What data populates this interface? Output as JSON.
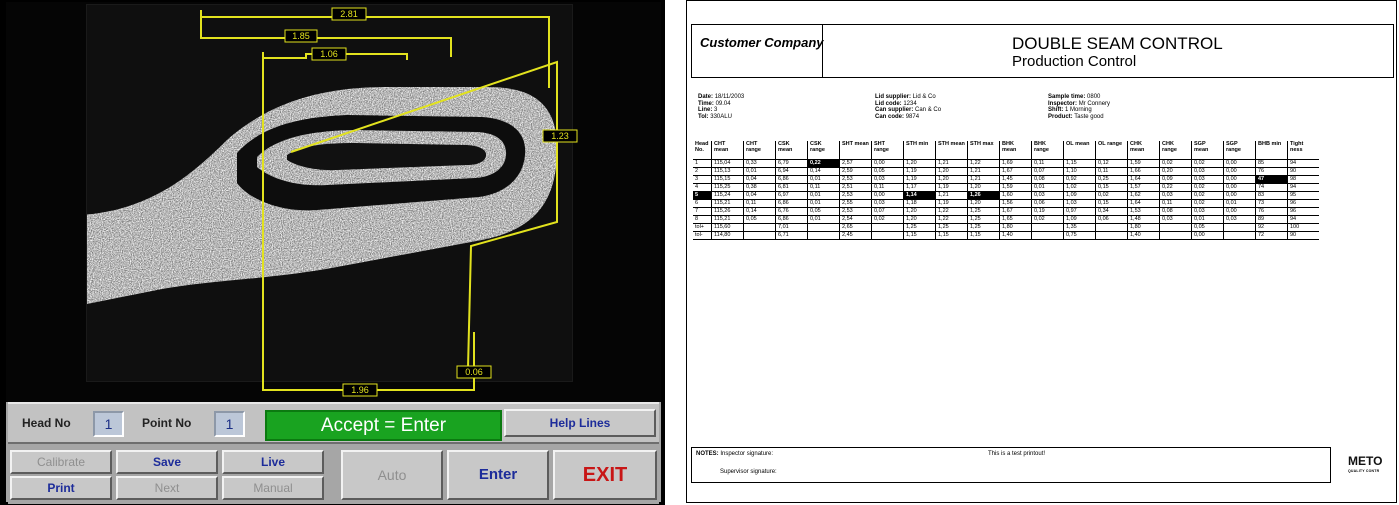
{
  "station": {
    "dimensions": [
      "2.81",
      "1.85",
      "1.06",
      "1.23",
      "0.06",
      "1.96"
    ],
    "info_bar": {
      "head_label": "Head No",
      "head_value": "1",
      "point_label": "Point No",
      "point_value": "1",
      "accept_text": "Accept = Enter",
      "help_lines_label": "Help Lines"
    },
    "buttons": {
      "calibrate": "Calibrate",
      "save": "Save",
      "live": "Live",
      "print": "Print",
      "next": "Next",
      "manual": "Manual",
      "auto": "Auto",
      "enter": "Enter",
      "exit": "EXIT"
    },
    "colors": {
      "accept_green": "#19a320",
      "button_blue": "#1d2c9a",
      "exit_red": "#c81616",
      "dimension_yellow": "#e2e21e"
    }
  },
  "report": {
    "company": "Customer Company",
    "title": "DOUBLE SEAM CONTROL",
    "subtitle": "Production Control",
    "meta": {
      "col1": [
        {
          "k": "Date:",
          "v": "18/11/2003"
        },
        {
          "k": "Time:",
          "v": "09.04"
        },
        {
          "k": "Line:",
          "v": "3"
        },
        {
          "k": "Tol:",
          "v": "330ALU"
        }
      ],
      "col2": [
        {
          "k": "Lid supplier:",
          "v": "Lid & Co"
        },
        {
          "k": "Lid code:",
          "v": "1234"
        },
        {
          "k": "Can supplier:",
          "v": "Can & Co"
        },
        {
          "k": "Can code:",
          "v": "9874"
        }
      ],
      "col3": [
        {
          "k": "Sample time:",
          "v": "0800"
        },
        {
          "k": "Inspector:",
          "v": "Mr Connery"
        },
        {
          "k": "Shift:",
          "v": "1 Morning"
        },
        {
          "k": "Product:",
          "v": "Taste good"
        }
      ]
    },
    "columns": [
      "Head No.",
      "CHT mean",
      "CHT range",
      "CSK mean",
      "CSK range",
      "SHT mean",
      "SHT range",
      "STH min",
      "STH mean",
      "STH max",
      "BHK mean",
      "BHK range",
      "OL mean",
      "OL range",
      "CHK mean",
      "CHK range",
      "SGP mean",
      "SGP range",
      "BHB min",
      "Tight ness"
    ],
    "rows": [
      [
        "1",
        "115,04",
        "0,33",
        "6,79",
        "0,22",
        "2,57",
        "0,00",
        "1,20",
        "1,21",
        "1,22",
        "1,69",
        "0,11",
        "1,15",
        "0,12",
        "1,59",
        "0,02",
        "0,02",
        "0,00",
        "85",
        "94"
      ],
      [
        "2",
        "115,13",
        "0,01",
        "6,94",
        "0,14",
        "2,59",
        "0,05",
        "1,19",
        "1,20",
        "1,21",
        "1,67",
        "0,07",
        "1,10",
        "0,11",
        "1,66",
        "0,20",
        "0,03",
        "0,00",
        "76",
        "90"
      ],
      [
        "3",
        "115,15",
        "0,04",
        "6,86",
        "0,01",
        "2,53",
        "0,03",
        "1,19",
        "1,20",
        "1,21",
        "1,45",
        "0,08",
        "0,92",
        "0,25",
        "1,64",
        "0,09",
        "0,03",
        "0,00",
        "47",
        "98"
      ],
      [
        "4",
        "115,25",
        "0,38",
        "6,81",
        "0,11",
        "2,51",
        "0,11",
        "1,17",
        "1,19",
        "1,20",
        "1,59",
        "0,01",
        "1,02",
        "0,15",
        "1,57",
        "0,22",
        "0,02",
        "0,00",
        "74",
        "94"
      ],
      [
        "5",
        "115,24",
        "0,04",
        "6,97",
        "0,01",
        "2,53",
        "0,00",
        "1,14",
        "1,21",
        "1,26",
        "1,60",
        "0,03",
        "1,09",
        "0,02",
        "1,62",
        "0,03",
        "0,02",
        "0,00",
        "83",
        "95"
      ],
      [
        "6",
        "115,21",
        "0,11",
        "6,86",
        "0,01",
        "2,55",
        "0,03",
        "1,18",
        "1,19",
        "1,20",
        "1,56",
        "0,06",
        "1,03",
        "0,15",
        "1,64",
        "0,11",
        "0,02",
        "0,01",
        "73",
        "96"
      ],
      [
        "7",
        "115,26",
        "0,14",
        "6,76",
        "0,05",
        "2,53",
        "0,07",
        "1,20",
        "1,22",
        "1,25",
        "1,67",
        "0,19",
        "0,97",
        "0,34",
        "1,53",
        "0,08",
        "0,03",
        "0,00",
        "76",
        "96"
      ],
      [
        "8",
        "115,21",
        "0,05",
        "6,86",
        "0,01",
        "2,54",
        "0,02",
        "1,20",
        "1,22",
        "1,25",
        "1,65",
        "0,02",
        "1,09",
        "0,06",
        "1,48",
        "0,03",
        "0,01",
        "0,03",
        "89",
        "94"
      ],
      [
        "tol+",
        "115,60",
        "",
        "7,01",
        "",
        "2,65",
        "",
        "1,25",
        "1,25",
        "1,25",
        "1,80",
        "",
        "1,35",
        "",
        "1,80",
        "",
        "0,05",
        "",
        "92",
        "100"
      ],
      [
        "tol-",
        "114,80",
        "",
        "6,71",
        "",
        "2,45",
        "",
        "1,15",
        "1,15",
        "1,15",
        "1,40",
        "",
        "0,75",
        "",
        "1,40",
        "",
        "0,00",
        "",
        "72",
        "90"
      ]
    ],
    "highlights": [
      [
        0,
        4
      ],
      [
        2,
        18
      ],
      [
        4,
        0
      ],
      [
        4,
        7
      ],
      [
        4,
        9
      ]
    ],
    "notes": {
      "label": "NOTES:",
      "inspector_sig": "Inspector signature:",
      "supervisor_sig": "Supervisor signature:",
      "message": "This is a test printout!"
    },
    "logo": "METO",
    "logo_sub": "QUALITY CONTR"
  }
}
